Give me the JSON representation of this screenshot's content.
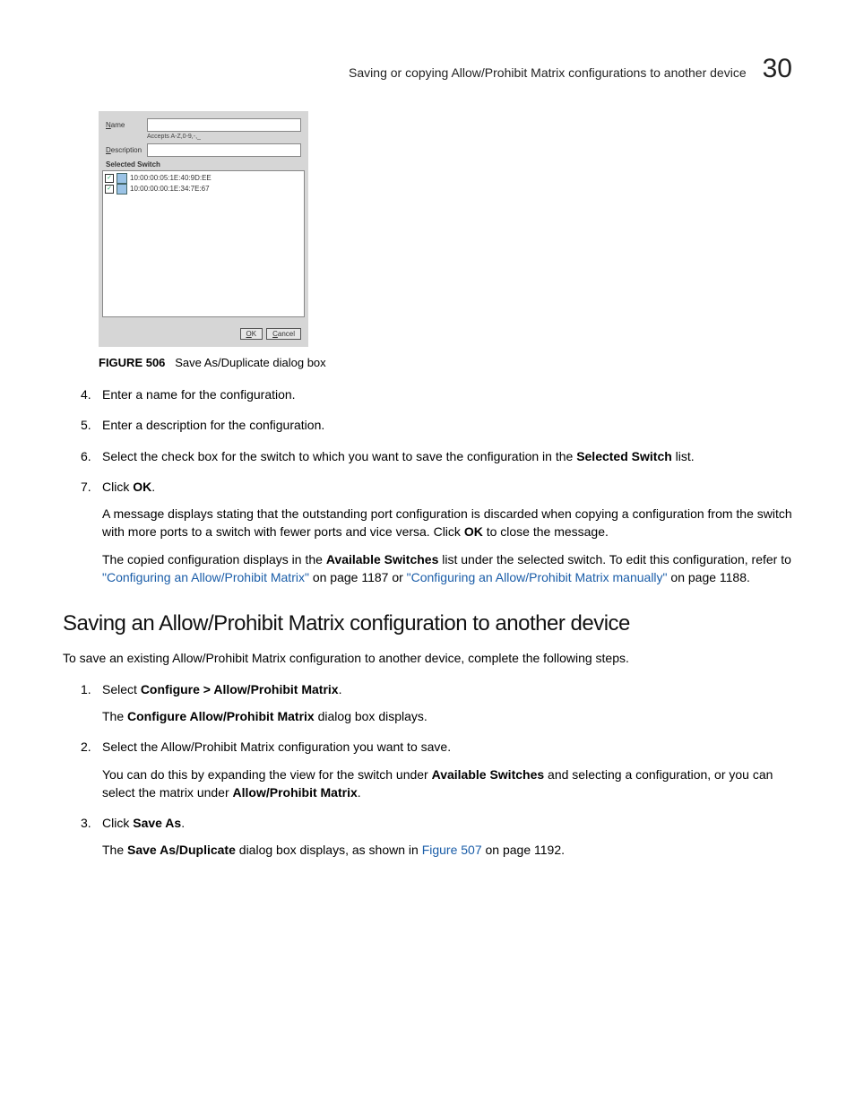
{
  "header": {
    "running_title": "Saving or copying Allow/Prohibit Matrix configurations to another device",
    "chapter": "30"
  },
  "dialog": {
    "name_label": "Name",
    "name_value": "",
    "accepts_hint": "Accepts A-Z,0-9,-,_",
    "description_label": "Description",
    "description_value": "",
    "selected_switch_label": "Selected Switch",
    "items": [
      {
        "checked": true,
        "label": "10:00:00:05:1E:40:9D:EE"
      },
      {
        "checked": true,
        "label": "10:00:00:00:1E:34:7E:67"
      }
    ],
    "ok": "OK",
    "cancel": "Cancel"
  },
  "figure506": {
    "label": "FIGURE 506",
    "caption": "Save As/Duplicate dialog box"
  },
  "steps_a": {
    "start": 3,
    "items": [
      {
        "text": "Enter a name for the configuration."
      },
      {
        "text": "Enter a description for the configuration."
      },
      {
        "text_pre": "Select the check box for the switch to which you want to save the configuration in the ",
        "bold": "Selected Switch",
        "text_post": " list."
      },
      {
        "text_pre": "Click ",
        "bold": "OK",
        "text_post": ".",
        "sub1_pre": "A message displays stating that the outstanding port configuration is discarded when copying a configuration from the switch with more ports to a switch with fewer ports and vice versa. Click ",
        "sub1_bold": "OK",
        "sub1_post": " to close the message.",
        "sub2_pre": "The copied configuration displays in the ",
        "sub2_bold": "Available Switches",
        "sub2_mid": " list under the selected switch. To edit this configuration, refer to ",
        "sub2_link1": "\"Configuring an Allow/Prohibit Matrix\"",
        "sub2_mid2": " on page 1187 or ",
        "sub2_link2": "\"Configuring an Allow/Prohibit Matrix manually\"",
        "sub2_post": " on page 1188."
      }
    ]
  },
  "section_h2": "Saving an Allow/Prohibit Matrix configuration to another device",
  "section_intro": "To save an existing Allow/Prohibit Matrix configuration to another device, complete the following steps.",
  "steps_b": {
    "items": [
      {
        "text_pre": "Select ",
        "bold": "Configure > Allow/Prohibit Matrix",
        "text_post": ".",
        "sub_pre": "The ",
        "sub_bold": "Configure Allow/Prohibit Matrix",
        "sub_post": " dialog box displays."
      },
      {
        "text": "Select the Allow/Prohibit Matrix configuration you want to save.",
        "sub_pre": "You can do this by expanding the view for the switch under ",
        "sub_bold": "Available Switches",
        "sub_mid": " and selecting a configuration, or you can select the matrix under ",
        "sub_bold2": "Allow/Prohibit Matrix",
        "sub_post": "."
      },
      {
        "text_pre": "Click ",
        "bold": "Save As",
        "text_post": ".",
        "sub_pre": "The ",
        "sub_bold": "Save As/Duplicate",
        "sub_mid": " dialog box displays, as shown in ",
        "sub_link": "Figure 507",
        "sub_post": " on page 1192."
      }
    ]
  }
}
